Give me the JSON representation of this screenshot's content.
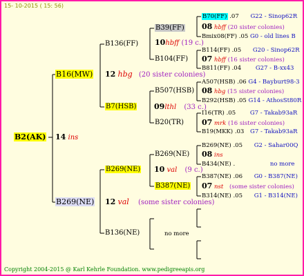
{
  "header_date": "15- 10-2015 ( 15: 56)",
  "footer": "Copyright 2004-2015 @ Karl Kehrle Foundation.   www.pedigreeapis.org",
  "root": {
    "id": "B2(AK)",
    "year": "14",
    "breed": "ins"
  },
  "gen1": {
    "top": {
      "id": "B16(MW)",
      "year": "12",
      "breed": "hbg",
      "sisters": "(20 sister colonies)"
    },
    "bottom": {
      "id": "B269(NE)",
      "year": "12",
      "breed": "val",
      "sisters": "(some sister colonies)"
    }
  },
  "gen2": {
    "a": {
      "id": "B136(FF)"
    },
    "b": {
      "id": "B7(HSB)",
      "year": "09",
      "breed": "lthl",
      "sisters": "(33 c.)"
    },
    "c": {
      "id": "B269(NE)",
      "year": "10",
      "breed": "val",
      "sisters": "(9 c.)"
    },
    "d": {
      "id": "B136(NE)",
      "no_more": "no more"
    }
  },
  "gen3": {
    "a1": {
      "id": "B39(FF)",
      "year": "10",
      "breed": "hbff",
      "sisters": "(19 c.)"
    },
    "a2": {
      "id": "B104(FF)",
      "year": "07",
      "breed": "hbff",
      "sisters": "(16 c.)"
    },
    "b1": {
      "id": "B507(HSB)",
      "year": "08",
      "breed": "hbg",
      "sisters": "(15 c.)"
    },
    "b2": {
      "id": "B20(TR)",
      "year": "07",
      "breed": "mrk",
      "sisters": "(16 c.)"
    },
    "c1": {
      "id": "B269(NE)",
      "year": "08",
      "breed": "ins"
    },
    "c2": {
      "id": "B387(NE)",
      "year": "07",
      "breed": "nst",
      "sisters": "(some sister colonies)"
    }
  },
  "gen4": [
    {
      "id": "B70(FF)",
      "year": ".07",
      "owner": "G22 - Sinop62R"
    },
    {
      "year": "08",
      "breed": "hbff",
      "sisters": "(20 sister colonies)"
    },
    {
      "id": "Bmix08(FF)",
      "year": ".05",
      "owner": "G0 - old lines B"
    },
    {
      "id": "B114(FF)",
      "year": ".05",
      "owner": "G20 - Sinop62R"
    },
    {
      "year": "07",
      "breed": "hbff",
      "sisters": "(16 sister colonies)"
    },
    {
      "id": "B811(FF)",
      "year": ".04",
      "owner": "G27 - B-xx43"
    },
    {
      "id": "A507(HSB)",
      "year": ".06",
      "owner": "G4 - Bayburt98-3"
    },
    {
      "year": "08",
      "breed": "hbg",
      "sisters": "(15 sister colonies)"
    },
    {
      "id": "B292(HSB)",
      "year": ".05",
      "owner": "G14 - AthosSt80R"
    },
    {
      "id": "I16(TR)",
      "year": ".05",
      "owner": "G7 - Takab93aR"
    },
    {
      "year": "07",
      "breed": "mrk",
      "sisters": "(16 sister colonies)"
    },
    {
      "id": "B19(MKK)",
      "year": ".03",
      "owner": "G7 - Takab93aR"
    },
    {
      "id": "B269(NE)",
      "year": ".05",
      "owner": "G2 - Sahar00Q"
    },
    {
      "year": "08",
      "breed": "ins"
    },
    {
      "id": "B434(NE)",
      "year": ".",
      "owner": "no more"
    },
    {
      "id": "B387(NE)",
      "year": ".06",
      "owner": "G0 - B387(NE)"
    },
    {
      "year": "07",
      "breed": "nst",
      "sisters": "(some sister colonies)"
    },
    {
      "id": "B314(NE)",
      "year": ".05",
      "owner": "G1 - B314(NE)"
    }
  ],
  "colors": {
    "border": "#ff1aa8",
    "background": "#fffde0",
    "highlight_yellow": "#ffff00",
    "highlight_cyan": "#00ffff",
    "sister_text": "#a020c0",
    "breed_text": "#dd0000",
    "owner_text": "#1010c0"
  }
}
